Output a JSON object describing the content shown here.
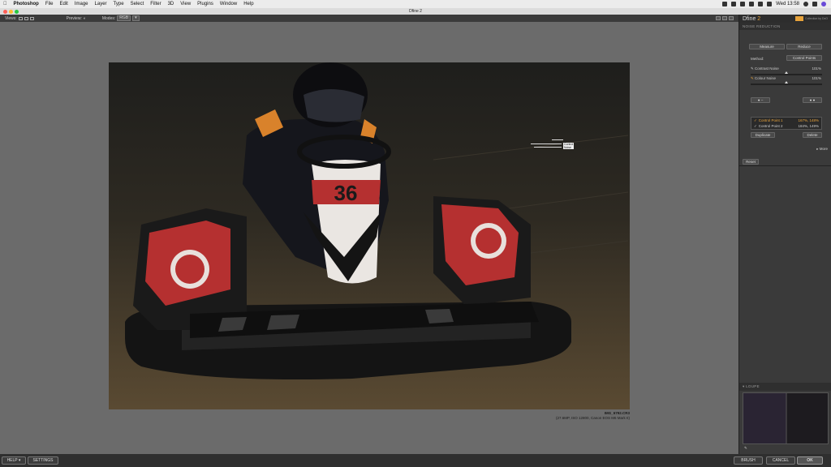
{
  "menubar": {
    "items": [
      "Photoshop",
      "File",
      "Edit",
      "Image",
      "Layer",
      "Type",
      "Select",
      "Filter",
      "3D",
      "View",
      "Plugins",
      "Window",
      "Help"
    ],
    "clock": "Wed 13:58"
  },
  "window": {
    "title": "Dfine 2"
  },
  "toolbar": {
    "views_label": "Views:",
    "preview_label": "Preview:",
    "modes_label": "Modes:",
    "mode_value": "RGB"
  },
  "image": {
    "filename": "IMG_6792.CR3",
    "meta": "(27.6MP, ISO 12800, Canon EOS M6 Mark II)",
    "kart_number": "36"
  },
  "control_point_label": "Control Noise",
  "panel": {
    "brand": "Dfine",
    "brand_version": "2",
    "collection_tag": "Collection by DxO",
    "section_title": "NOISE REDUCTION",
    "measure_tab": "Measure",
    "reduce_tab": "Reduce",
    "method_label": "Method:",
    "method_value": "Control Points",
    "contrast_noise_label": "Contrast Noise",
    "contrast_noise_value": "101%",
    "colour_noise_label": "Colour Noise",
    "colour_noise_value": "101%",
    "control_points": [
      {
        "name": "Control Point 1",
        "value": "167%, 148%"
      },
      {
        "name": "Control Point 2",
        "value": "184%, 149%"
      }
    ],
    "duplicate_button": "Duplicate",
    "delete_button": "Delete",
    "more_label": "More",
    "reset_button": "Reset",
    "loupe_title": "LOUPE"
  },
  "bottombar": {
    "help": "HELP ▾",
    "settings": "SETTINGS",
    "brush": "BRUSH",
    "cancel": "CANCEL",
    "ok": "OK"
  }
}
